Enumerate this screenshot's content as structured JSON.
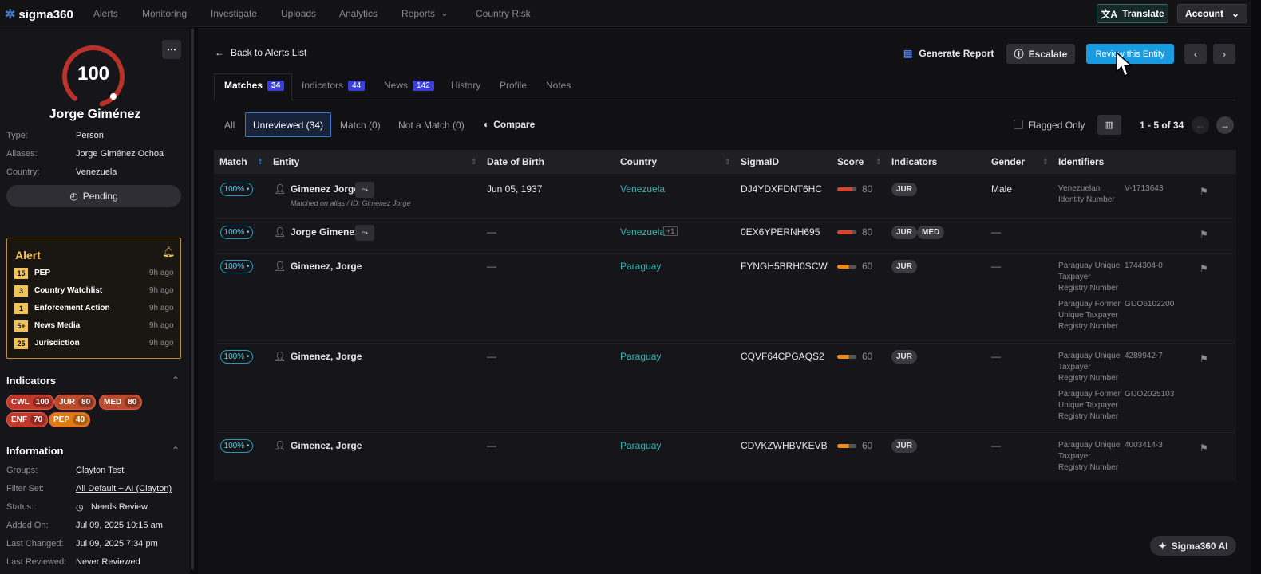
{
  "nav": {
    "logo": "sigma360",
    "items": [
      "Alerts",
      "Monitoring",
      "Investigate",
      "Uploads",
      "Analytics",
      "Reports",
      "Country Risk"
    ],
    "translate": "Translate",
    "account": "Account"
  },
  "entity": {
    "score": "100",
    "name": "Jorge Giménez",
    "type_label": "Type:",
    "type": "Person",
    "aliases_label": "Aliases:",
    "aliases": "Jorge Giménez Ochoa",
    "country_label": "Country:",
    "country": "Venezuela",
    "status_button": "Pending"
  },
  "alert": {
    "title": "Alert",
    "items": [
      {
        "count": "15",
        "label": "PEP",
        "time": "9h ago"
      },
      {
        "count": "3",
        "label": "Country Watchlist",
        "time": "9h ago"
      },
      {
        "count": "1",
        "label": "Enforcement Action",
        "time": "9h ago"
      },
      {
        "count": "5+",
        "label": "News Media",
        "time": "9h ago"
      },
      {
        "count": "25",
        "label": "Jurisdiction",
        "time": "9h ago"
      }
    ]
  },
  "indicators": {
    "title": "Indicators",
    "badges": [
      {
        "code": "CWL",
        "value": "100",
        "color": "#c0392b"
      },
      {
        "code": "JUR",
        "value": "80",
        "color": "#b94a2c"
      },
      {
        "code": "MED",
        "value": "80",
        "color": "#b94a2c"
      },
      {
        "code": "ENF",
        "value": "70",
        "color": "#c0392b"
      },
      {
        "code": "PEP",
        "value": "40",
        "color": "#e07b12"
      }
    ]
  },
  "information": {
    "title": "Information",
    "groups_label": "Groups:",
    "groups": "Clayton Test",
    "filterset_label": "Filter Set:",
    "filterset": "All Default + AI (Clayton)",
    "status_label": "Status:",
    "status": "Needs Review",
    "added_label": "Added On:",
    "added": "Jul 09, 2025 10:15 am",
    "changed_label": "Last Changed:",
    "changed": "Jul 09, 2025 7:34 pm",
    "reviewed_label": "Last Reviewed:",
    "reviewed": "Never Reviewed"
  },
  "header": {
    "back": "Back to Alerts List",
    "generate": "Generate Report",
    "escalate": "Escalate",
    "review": "Review this Entity"
  },
  "tabs": [
    {
      "label": "Matches",
      "count": "34"
    },
    {
      "label": "Indicators",
      "count": "44"
    },
    {
      "label": "News",
      "count": "142"
    },
    {
      "label": "History"
    },
    {
      "label": "Profile"
    },
    {
      "label": "Notes"
    }
  ],
  "filters": {
    "all": "All",
    "unreviewed": "Unreviewed (34)",
    "match": "Match (0)",
    "notmatch": "Not a Match (0)",
    "compare": "Compare",
    "flagged": "Flagged Only",
    "pagination": "1 - 5 of 34"
  },
  "columns": [
    "Match",
    "Entity",
    "Date of Birth",
    "Country",
    "SigmaID",
    "Score",
    "Indicators",
    "Gender",
    "Identifiers"
  ],
  "rows": [
    {
      "match": "100%",
      "entity": "Gimenez Jorge",
      "sub": "Matched on alias / ID: Gimenez Jorge",
      "dob": "Jun 05, 1937",
      "country": "Venezuela",
      "extra": "",
      "sigma": "DJ4YDXFDNT6HC",
      "score": "80",
      "inds": [
        "JUR"
      ],
      "gender": "Male",
      "ids": [
        {
          "name": "Venezuelan\nIdentity Number",
          "value": "V-1713643"
        }
      ]
    },
    {
      "match": "100%",
      "entity": "Jorge Gimenez",
      "sub": "",
      "dob": "—",
      "country": "Venezuela",
      "extra": "+1",
      "sigma": "0EX6YPERNH695",
      "score": "80",
      "inds": [
        "JUR",
        "MED"
      ],
      "gender": "—",
      "ids": []
    },
    {
      "match": "100%",
      "entity": "Gimenez, Jorge",
      "sub": "",
      "dob": "—",
      "country": "Paraguay",
      "extra": "",
      "sigma": "FYNGH5BRH0SCW",
      "score": "60",
      "inds": [
        "JUR"
      ],
      "gender": "—",
      "ids": [
        {
          "name": "Paraguay Unique\nTaxpayer\nRegistry Number",
          "value": "1744304-0"
        },
        {
          "name": "Paraguay Former\nUnique Taxpayer\nRegistry Number",
          "value": "GIJO6102200"
        }
      ]
    },
    {
      "match": "100%",
      "entity": "Gimenez, Jorge",
      "sub": "",
      "dob": "—",
      "country": "Paraguay",
      "extra": "",
      "sigma": "CQVF64CPGAQS2",
      "score": "60",
      "inds": [
        "JUR"
      ],
      "gender": "—",
      "ids": [
        {
          "name": "Paraguay Unique\nTaxpayer\nRegistry Number",
          "value": "4289942-7"
        },
        {
          "name": "Paraguay Former\nUnique Taxpayer\nRegistry Number",
          "value": "GIJO2025103"
        }
      ]
    },
    {
      "match": "100%",
      "entity": "Gimenez, Jorge",
      "sub": "",
      "dob": "—",
      "country": "Paraguay",
      "extra": "",
      "sigma": "CDVKZWHBVKEVB",
      "score": "60",
      "inds": [
        "JUR"
      ],
      "gender": "—",
      "ids": [
        {
          "name": "Paraguay Unique\nTaxpayer\nRegistry Number",
          "value": "4003414-3"
        }
      ]
    }
  ],
  "ai_button": "Sigma360 AI"
}
